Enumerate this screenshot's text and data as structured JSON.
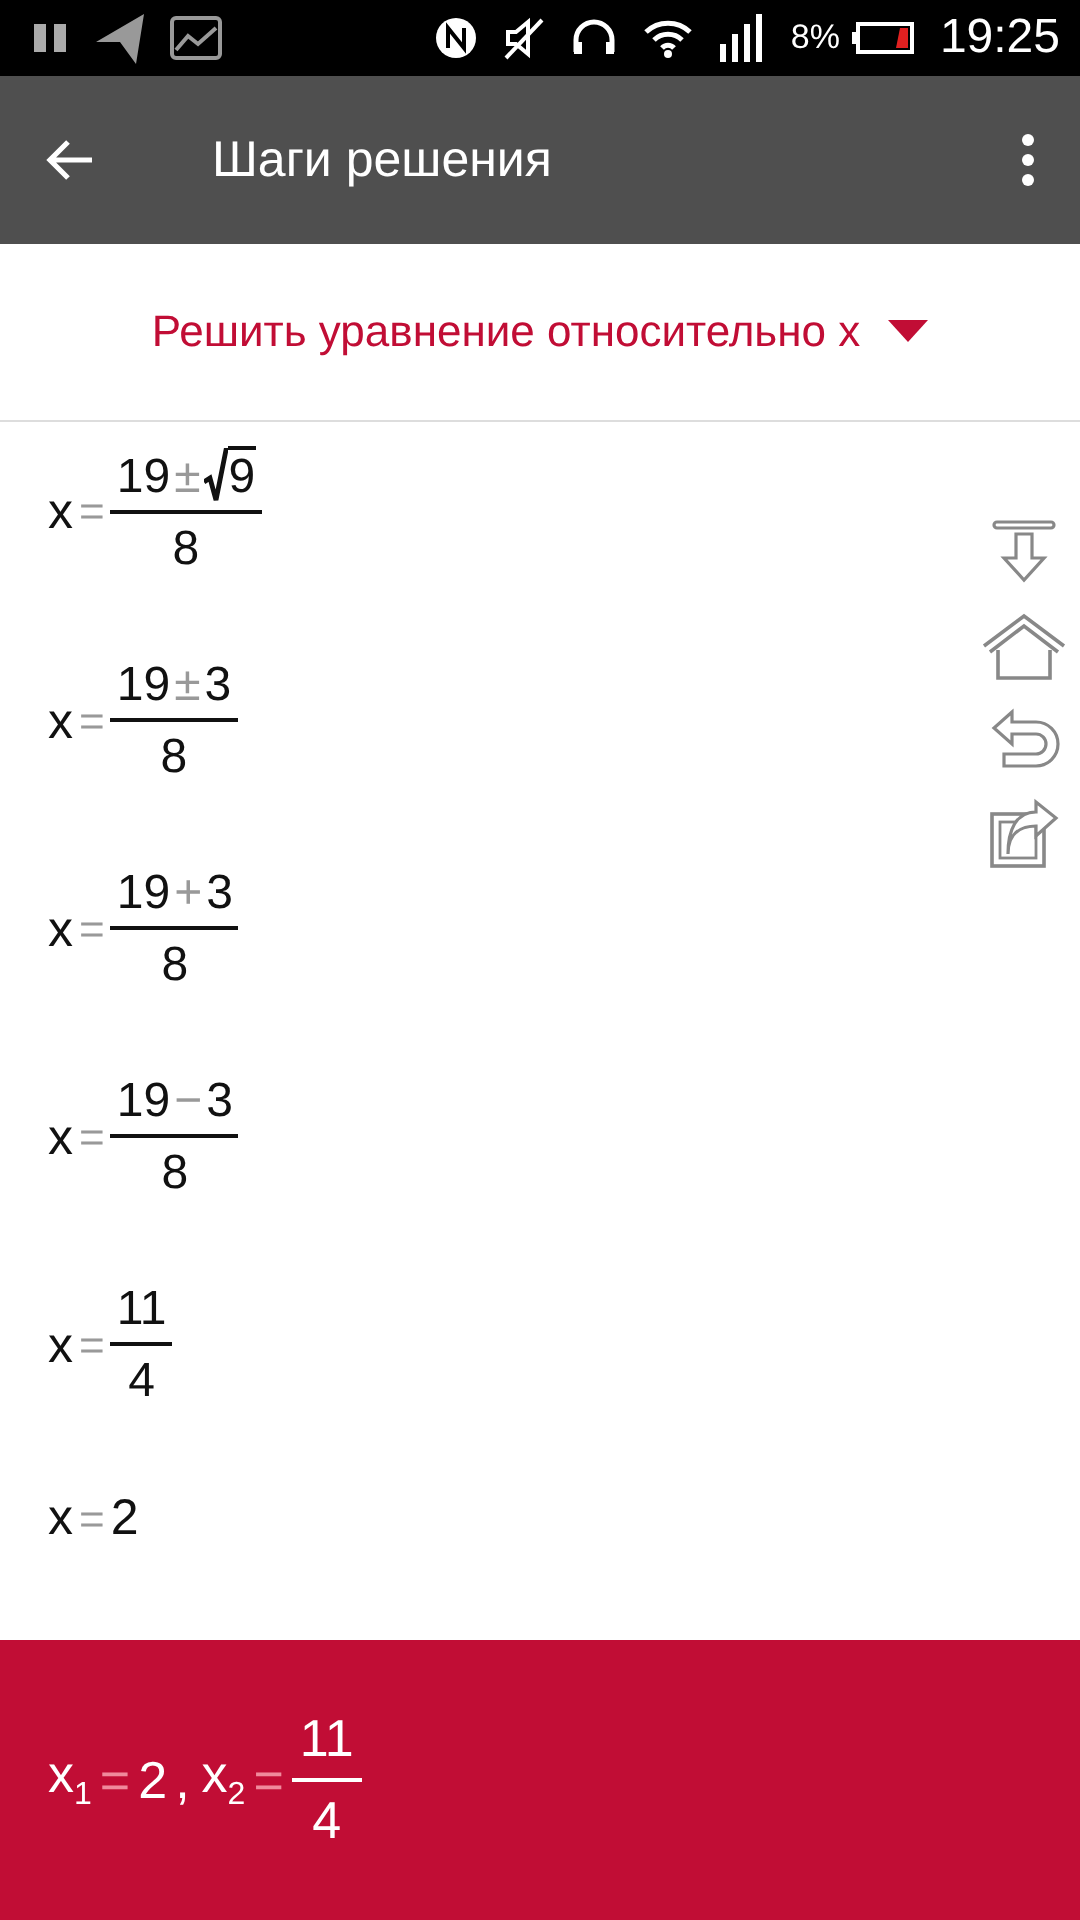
{
  "status_bar": {
    "battery": "8%",
    "time": "19:25"
  },
  "toolbar": {
    "title": "Шаги решения"
  },
  "mode": {
    "label": "Решить уравнение относительно x"
  },
  "steps": [
    {
      "var": "x",
      "eq": "=",
      "kind": "fraction",
      "num": [
        {
          "kind": "num",
          "text": "19"
        },
        {
          "kind": "op",
          "text": "±"
        },
        {
          "kind": "sqrt",
          "text": "9"
        }
      ],
      "den": "8"
    },
    {
      "var": "x",
      "eq": "=",
      "kind": "fraction",
      "num": [
        {
          "kind": "num",
          "text": "19"
        },
        {
          "kind": "op",
          "text": "±"
        },
        {
          "kind": "num",
          "text": "3"
        }
      ],
      "den": "8"
    },
    {
      "var": "x",
      "eq": "=",
      "kind": "fraction",
      "num": [
        {
          "kind": "num",
          "text": "19"
        },
        {
          "kind": "op",
          "text": "+"
        },
        {
          "kind": "num",
          "text": "3"
        }
      ],
      "den": "8"
    },
    {
      "var": "x",
      "eq": "=",
      "kind": "fraction",
      "num": [
        {
          "kind": "num",
          "text": "19"
        },
        {
          "kind": "op",
          "text": "−"
        },
        {
          "kind": "num",
          "text": "3"
        }
      ],
      "den": "8"
    },
    {
      "var": "x",
      "eq": "=",
      "kind": "fraction",
      "num": [
        {
          "kind": "num",
          "text": "11"
        }
      ],
      "den": "4"
    },
    {
      "var": "x",
      "eq": "=",
      "kind": "value",
      "value": "2"
    }
  ],
  "result": [
    {
      "kind": "var",
      "text": "x",
      "sub": "1"
    },
    {
      "kind": "op",
      "text": "="
    },
    {
      "kind": "num",
      "text": "2"
    },
    {
      "kind": "sep",
      "text": ","
    },
    {
      "kind": "var",
      "text": "x",
      "sub": "2"
    },
    {
      "kind": "op",
      "text": "="
    },
    {
      "kind": "frac",
      "num": "11",
      "den": "4"
    }
  ]
}
